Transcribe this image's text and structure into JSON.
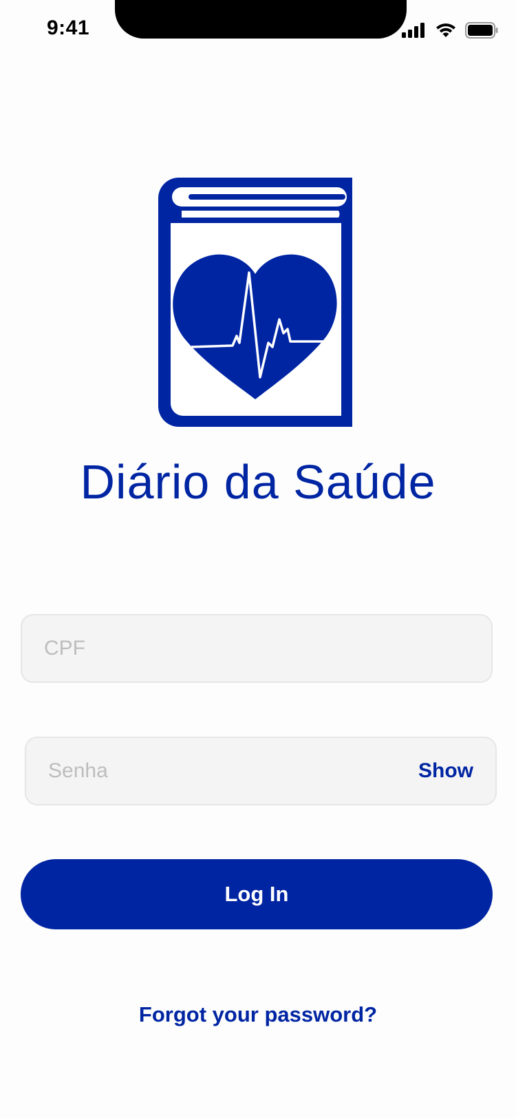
{
  "status_bar": {
    "time": "9:41",
    "icons": [
      "signal-icon",
      "wifi-icon",
      "battery-icon"
    ]
  },
  "brand": {
    "logo": "book-heart-ecg-logo",
    "title": "Diário da Saúde",
    "color": "#0025a3"
  },
  "form": {
    "cpf_placeholder": "CPF",
    "cpf_value": "",
    "password_placeholder": "Senha",
    "password_value": "",
    "show_label": "Show",
    "login_label": "Log In",
    "forgot_label": "Forgot your password?"
  }
}
